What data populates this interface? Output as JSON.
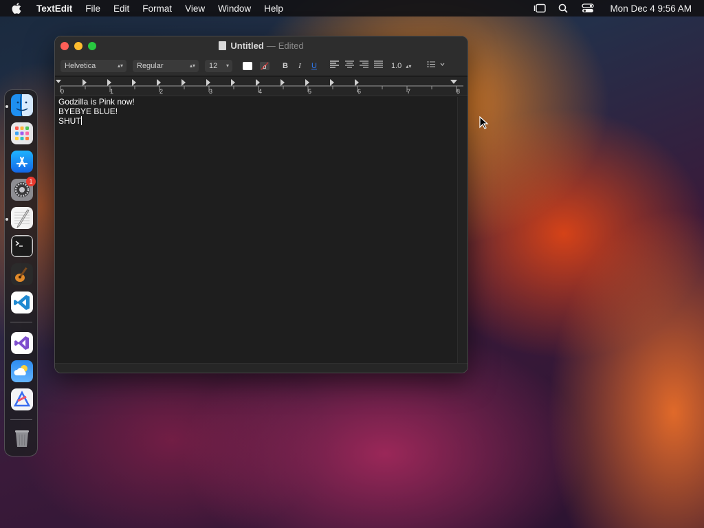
{
  "menubar": {
    "app_name": "TextEdit",
    "items": [
      "File",
      "Edit",
      "Format",
      "View",
      "Window",
      "Help"
    ],
    "clock": "Mon Dec 4  9:56 AM"
  },
  "dock": {
    "apps": [
      "Finder",
      "Launchpad",
      "App Store",
      "System Settings",
      "TextEdit",
      "Terminal",
      "GarageBand",
      "Visual Studio Code",
      "Visual Studio",
      "Weather",
      "Affinity",
      "Trash"
    ],
    "settings_badge": "1"
  },
  "window": {
    "title": "Untitled",
    "title_sep": "—",
    "edited": "Edited",
    "toolbar": {
      "font_family": "Helvetica",
      "font_style": "Regular",
      "font_size": "12",
      "bold": "B",
      "italic": "I",
      "underline": "U",
      "line_spacing": "1.0"
    },
    "ruler_numbers": [
      "0",
      "1",
      "2",
      "3",
      "4",
      "5",
      "6",
      "7",
      "8"
    ],
    "lines": [
      "Godzilla is Pink now!",
      "BYEBYE BLUE!",
      "SHUT"
    ]
  },
  "colors": {
    "accent_blue": "#2f7bf6",
    "close": "#ff5f57",
    "minimize": "#febc2e",
    "zoom": "#28c840"
  }
}
